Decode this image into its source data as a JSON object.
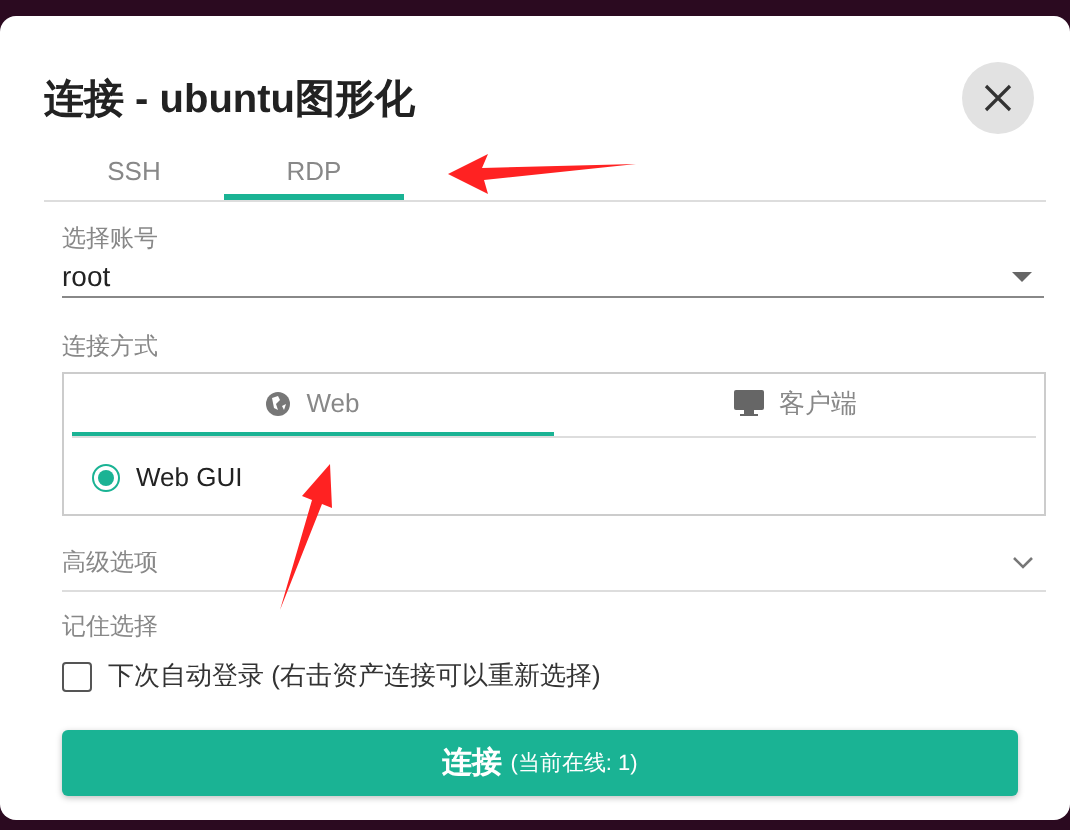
{
  "dialog": {
    "title": "连接 - ubuntu图形化"
  },
  "protocol_tabs": [
    {
      "label": "SSH",
      "selected": false
    },
    {
      "label": "RDP",
      "selected": true
    }
  ],
  "account": {
    "label": "选择账号",
    "value": "root"
  },
  "connect_method": {
    "label": "连接方式",
    "tabs": [
      {
        "kind": "web",
        "label": "Web",
        "selected": true
      },
      {
        "kind": "client",
        "label": "客户端",
        "selected": false
      }
    ],
    "options": [
      {
        "label": "Web GUI",
        "selected": true
      }
    ]
  },
  "advanced": {
    "label": "高级选项",
    "expanded": false
  },
  "remember": {
    "label": "记住选择",
    "checkbox": {
      "label": "下次自动登录 (右击资产连接可以重新选择)",
      "checked": false
    }
  },
  "connect_button": {
    "label": "连接",
    "status": "(当前在线: 1)"
  }
}
